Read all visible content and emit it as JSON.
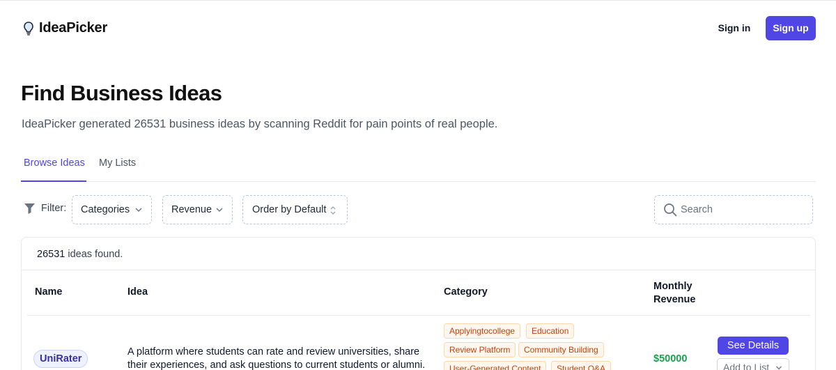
{
  "brand": {
    "name": "IdeaPicker",
    "logo_icon": "lightbulb-icon"
  },
  "nav": {
    "sign_in": "Sign in",
    "sign_up": "Sign up",
    "accent_color": "#4f46e5"
  },
  "hero": {
    "title": "Find Business Ideas",
    "subtitle": "IdeaPicker generated 26531 business ideas by scanning Reddit for pain points of real people."
  },
  "tabs": [
    {
      "label": "Browse Ideas",
      "active": true
    },
    {
      "label": "My Lists",
      "active": false
    }
  ],
  "filters": {
    "label": "Filter:",
    "icon": "funnel-icon",
    "categories": "Categories",
    "revenue": "Revenue",
    "order": "Order by Default",
    "search_placeholder": "Search"
  },
  "results": {
    "count": "26531",
    "count_suffix": " ideas found."
  },
  "table": {
    "headers": {
      "name": "Name",
      "idea": "Idea",
      "category": "Category",
      "revenue": "Monthly Revenue"
    },
    "rows": [
      {
        "name": "UniRater",
        "idea": "A platform where students can rate and review universities, share their experiences, and ask questions to current students or alumni.",
        "tags": [
          "Applyingtocollege",
          "Education",
          "Review Platform",
          "Community Building",
          "User-Generated Content",
          "Student Q&A"
        ],
        "revenue": "$50000",
        "revenue_color": "#16a34a",
        "details_label": "See Details",
        "add_label": "Add to List"
      }
    ]
  }
}
